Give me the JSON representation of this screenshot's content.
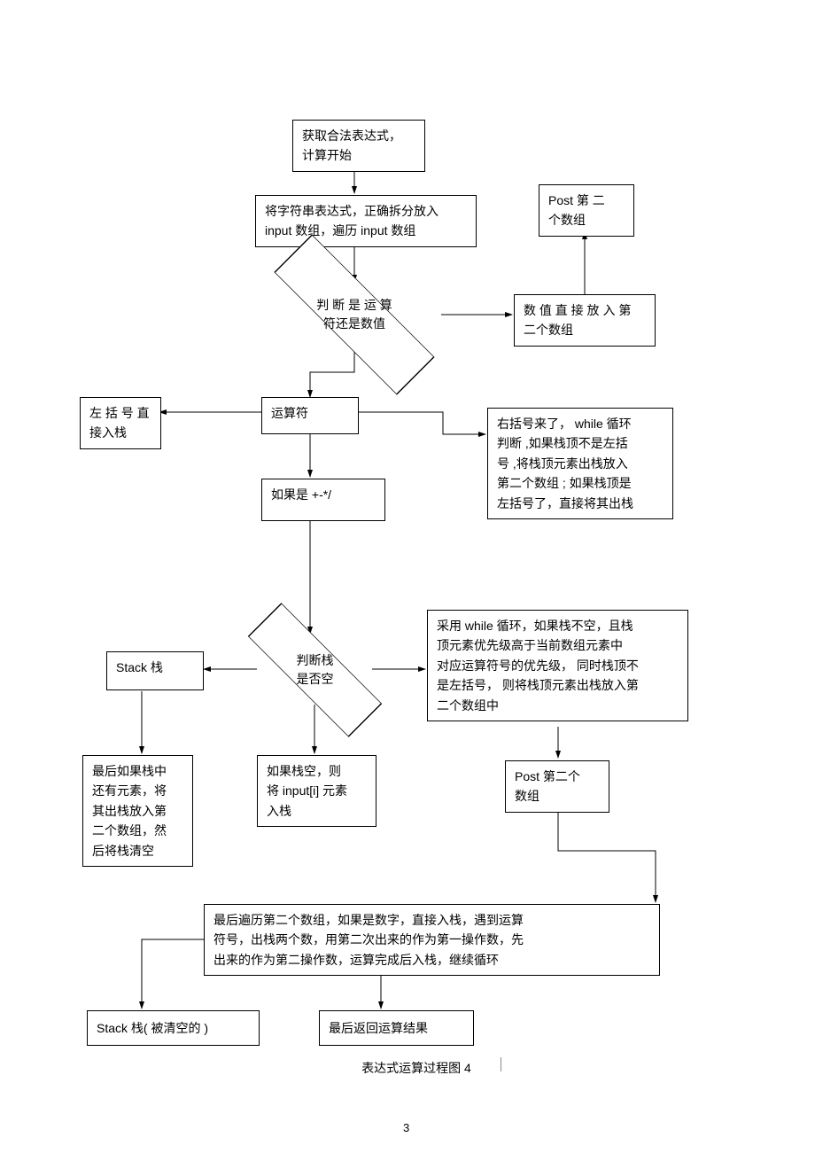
{
  "nodes": {
    "start": "获取合法表达式，\n计算开始",
    "split": "将字符串表达式，正确拆分放入\ninput 数组，遍历   input 数组",
    "post_top": "Post 第 二\n个数组",
    "numvalue": "数 值 直 接 放 入 第\n二个数组",
    "decide1": "判 断 是 运 算\n符还是数值",
    "leftparen": "左 括 号 直\n接入栈",
    "operator": "运算符",
    "rightparen": "右括号来了，  while 循环\n判断 ,如果栈顶不是左括\n号 ,将栈顶元素出栈放入\n第二个数组 ; 如果栈顶是\n左括号了，直接将其出栈",
    "pmmd": "如果是 +-*/",
    "stack": "Stack 栈",
    "decide2": "判断栈\n是否空",
    "whileloop": "采用 while 循环，如果栈不空，且栈\n顶元素优先级高于当前数组元素中\n对应运算符号的优先级，   同时栈顶不\n是左括号，  则将栈顶元素出栈放入第\n二个数组中",
    "remain": "最后如果栈中\n还有元素，将\n其出栈放入第\n二个数组，然\n后将栈清空",
    "ifempty": "如果栈空，则\n将 input[i] 元素\n入栈",
    "post_mid": "Post 第二个\n数组",
    "traverse": "最后遍历第二个数组，如果是数字，直接入栈，遇到运算\n符号，出栈两个数，用第二次出来的作为第一操作数，先\n出来的作为第二操作数，运算完成后入栈，继续循环",
    "cleared": "Stack 栈( 被清空的 )",
    "result": "最后返回运算结果"
  },
  "caption": "表达式运算过程图     4",
  "page_number": "3"
}
